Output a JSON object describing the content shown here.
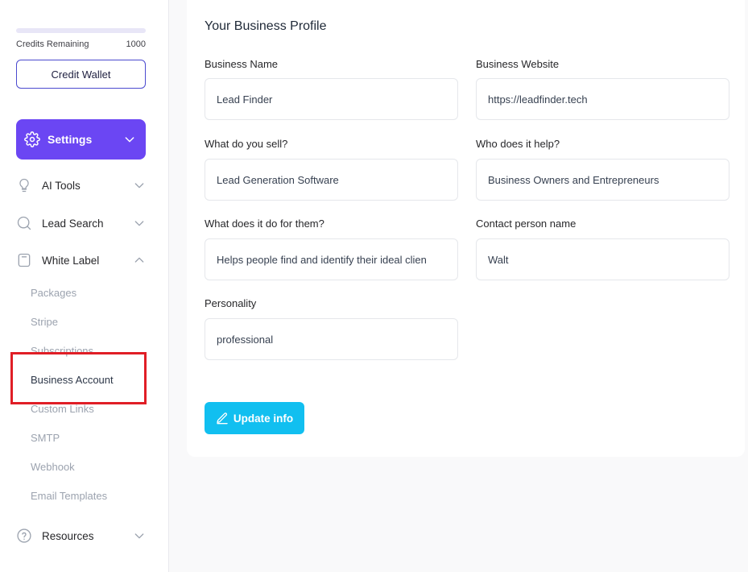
{
  "sidebar": {
    "credits_label": "Credits Remaining",
    "credits_value": "1000",
    "credits_fill_fraction": 1.0,
    "credit_wallet_label": "Credit Wallet",
    "settings_label": "Settings",
    "nav": [
      {
        "label": "AI Tools",
        "icon": "lightbulb-icon",
        "expanded": false
      },
      {
        "label": "Lead Search",
        "icon": "search-icon",
        "expanded": false
      },
      {
        "label": "White Label",
        "icon": "tag-icon",
        "expanded": true
      }
    ],
    "sub_items": [
      "Packages",
      "Stripe",
      "Subscriptions",
      "Business Account",
      "Custom Links",
      "SMTP",
      "Webhook",
      "Email Templates"
    ],
    "active_sub_item": "Business Account",
    "resources_label": "Resources"
  },
  "profile": {
    "title": "Your Business Profile",
    "fields": {
      "business_name": {
        "label": "Business Name",
        "value": "Lead Finder"
      },
      "business_website": {
        "label": "Business Website",
        "value": "https://leadfinder.tech"
      },
      "what_sell": {
        "label": "What do you sell?",
        "value": "Lead Generation Software"
      },
      "who_help": {
        "label": "Who does it help?",
        "value": "Business Owners and Entrepreneurs"
      },
      "what_do": {
        "label": "What does it do for them?",
        "value": "Helps people find and identify their ideal clien"
      },
      "contact_name": {
        "label": "Contact person name",
        "value": "Walt"
      },
      "personality": {
        "label": "Personality",
        "value": "professional"
      }
    },
    "update_label": "Update info"
  },
  "colors": {
    "accent_purple": "#6b46f3",
    "accent_cyan": "#11bff0",
    "highlight_red": "#e01e26"
  }
}
